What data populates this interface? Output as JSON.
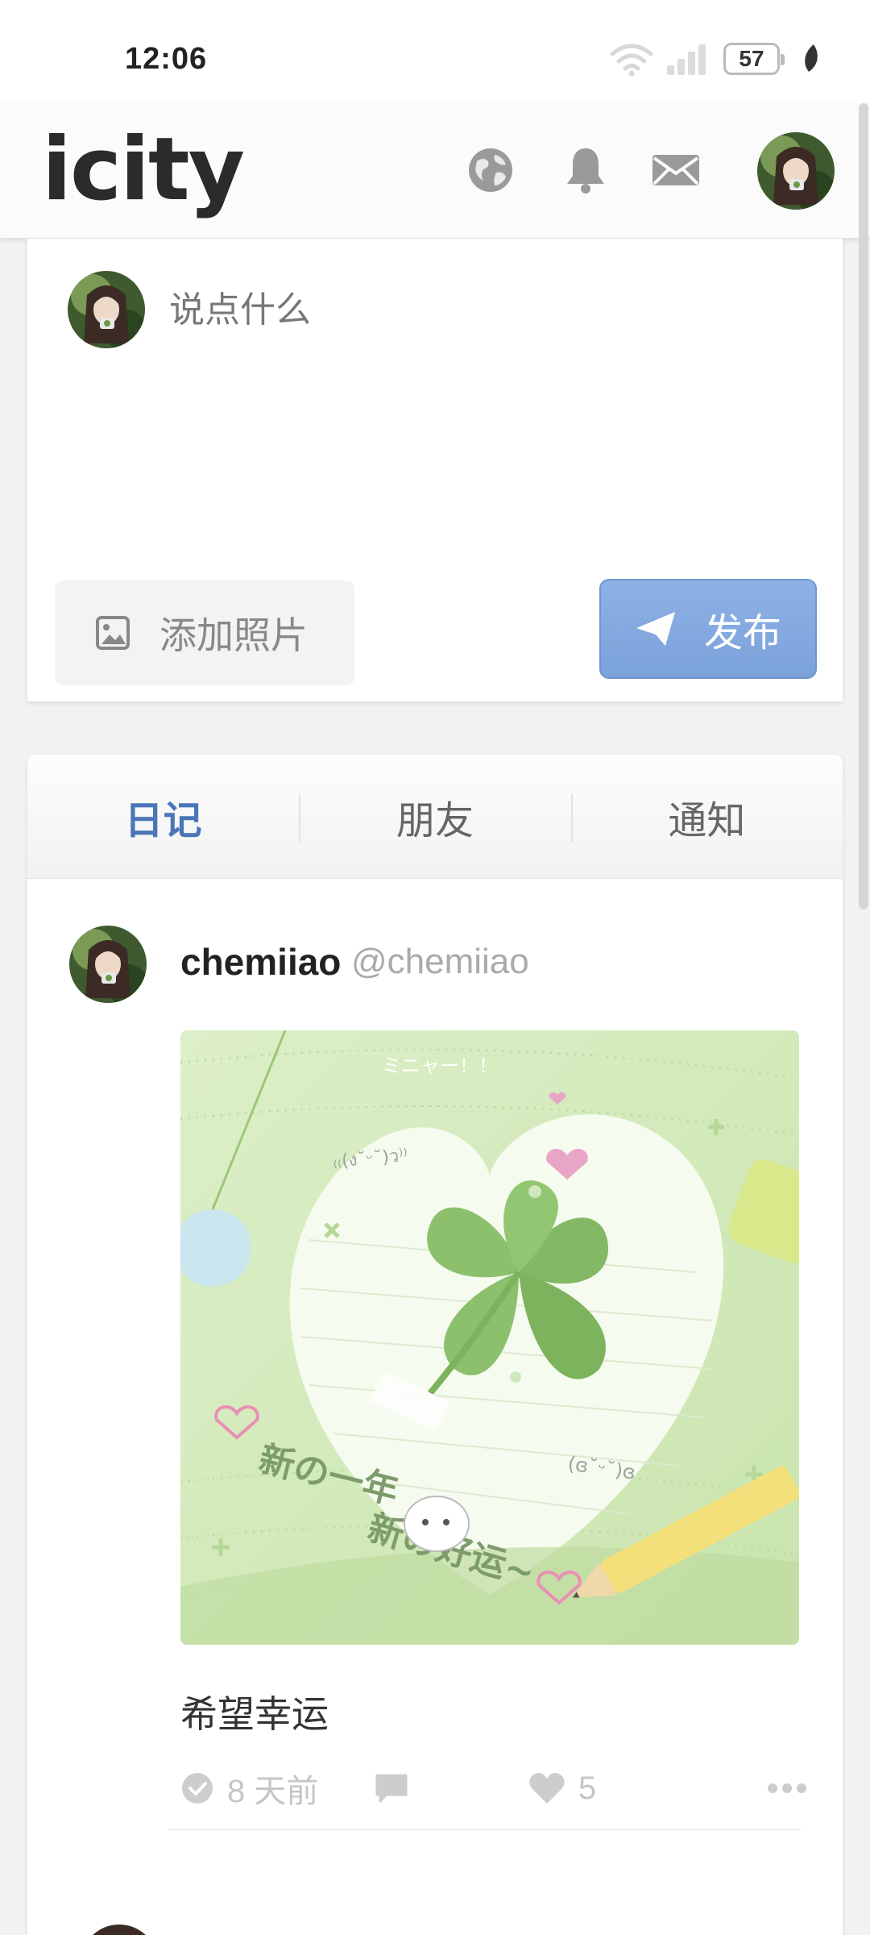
{
  "status_bar": {
    "time": "12:06",
    "battery": "57"
  },
  "header": {
    "logo": "icity",
    "icons": [
      "globe-icon",
      "bell-icon",
      "mail-icon"
    ]
  },
  "compose": {
    "placeholder": "说点什么",
    "add_photo": "添加照片",
    "publish": "发布"
  },
  "tabs": [
    {
      "label": "日记",
      "active": true
    },
    {
      "label": "朋友",
      "active": false
    },
    {
      "label": "通知",
      "active": false
    }
  ],
  "post": {
    "name": "chemiiao",
    "handle": "@chemiiao",
    "image_text": {
      "top": "ミニャー！！",
      "kaomoji_1": "₍₍(ง˘ᵕ˘)ว⁾⁾",
      "kaomoji_2": "(ɞ˘ᵕ˘)ɞ",
      "line_1": "新の一年",
      "line_2": "新の好运~"
    },
    "text": "希望幸运",
    "time": "8 天前",
    "likes": "5"
  },
  "colors": {
    "accent": "#4a76b8",
    "publish_button": "#7ba2da",
    "muted": "#c6c6c6"
  }
}
